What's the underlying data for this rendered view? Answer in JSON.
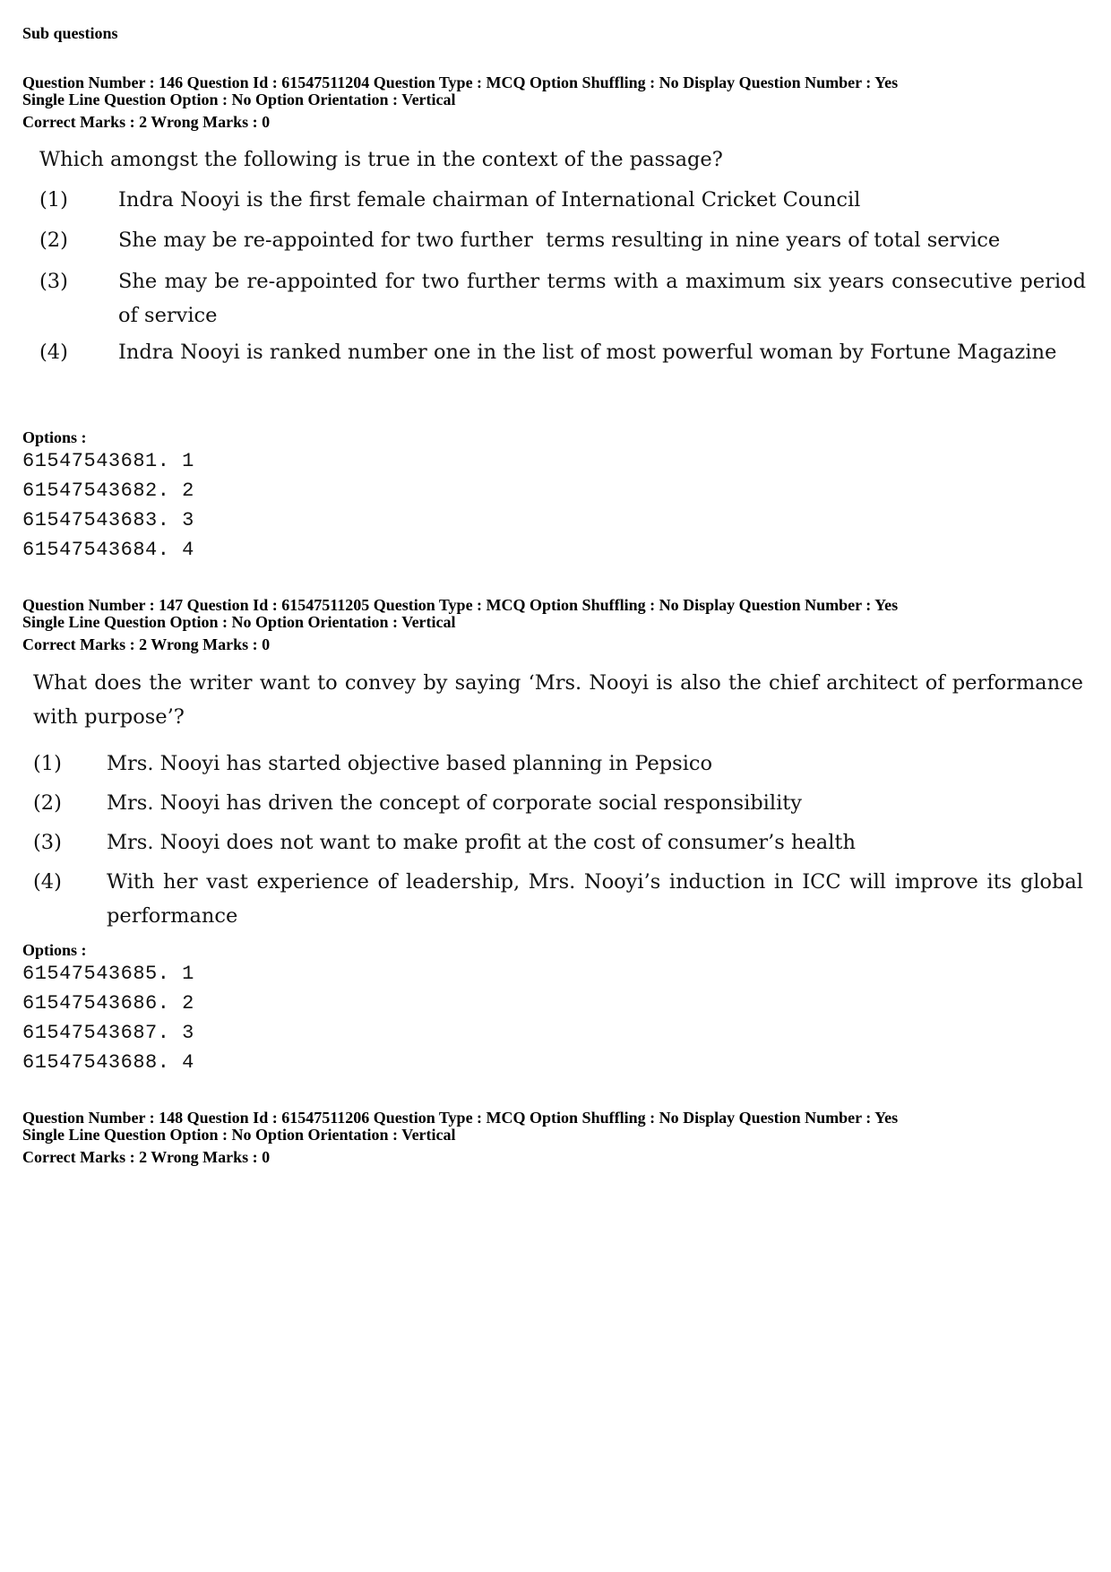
{
  "heading": "Sub questions",
  "questions": [
    {
      "meta_line1": "Question Number : 146  Question Id : 61547511204  Question Type : MCQ  Option Shuffling : No  Display Question Number : Yes",
      "meta_line2": "Single Line Question Option : No  Option Orientation : Vertical",
      "marks_line": "Correct Marks : 2  Wrong Marks : 0",
      "stem": "Which amongst the following is true in the context of the passage?",
      "choices": [
        {
          "num": "(1)",
          "text": "Indra Nooyi is the first female chairman of International Cricket Council"
        },
        {
          "num": "(2)",
          "text": "She may be re-appointed for two further  terms resulting in nine years of total service"
        },
        {
          "num": "(3)",
          "text": "She may be re-appointed for two further terms with a maximum six years consecutive period of service"
        },
        {
          "num": "(4)",
          "text": "Indra Nooyi is ranked number one in the list of most powerful woman by Fortune Magazine"
        }
      ],
      "options_label": "Options :",
      "option_ids": [
        "61547543681. 1",
        "61547543682. 2",
        "61547543683. 3",
        "61547543684. 4"
      ]
    },
    {
      "meta_line1": "Question Number : 147  Question Id : 61547511205  Question Type : MCQ  Option Shuffling : No  Display Question Number : Yes",
      "meta_line2": "Single Line Question Option : No  Option Orientation : Vertical",
      "marks_line": "Correct Marks : 2  Wrong Marks : 0",
      "stem": "What does the writer want to convey by saying ‘Mrs. Nooyi is also the chief architect of performance with purpose’?",
      "choices": [
        {
          "num": "(1)",
          "text": "Mrs. Nooyi has started objective based planning in Pepsico"
        },
        {
          "num": "(2)",
          "text": "Mrs. Nooyi has driven the concept of corporate social responsibility"
        },
        {
          "num": "(3)",
          "text": "Mrs. Nooyi does not want to make profit at the cost of consumer’s health"
        },
        {
          "num": "(4)",
          "text": "With her vast experience of leadership, Mrs. Nooyi’s induction in ICC will improve its global performance"
        }
      ],
      "options_label": "Options :",
      "option_ids": [
        "61547543685. 1",
        "61547543686. 2",
        "61547543687. 3",
        "61547543688. 4"
      ]
    },
    {
      "meta_line1": "Question Number : 148  Question Id : 61547511206  Question Type : MCQ  Option Shuffling : No  Display Question Number : Yes",
      "meta_line2": "Single Line Question Option : No  Option Orientation : Vertical",
      "marks_line": "Correct Marks : 2  Wrong Marks : 0"
    }
  ]
}
